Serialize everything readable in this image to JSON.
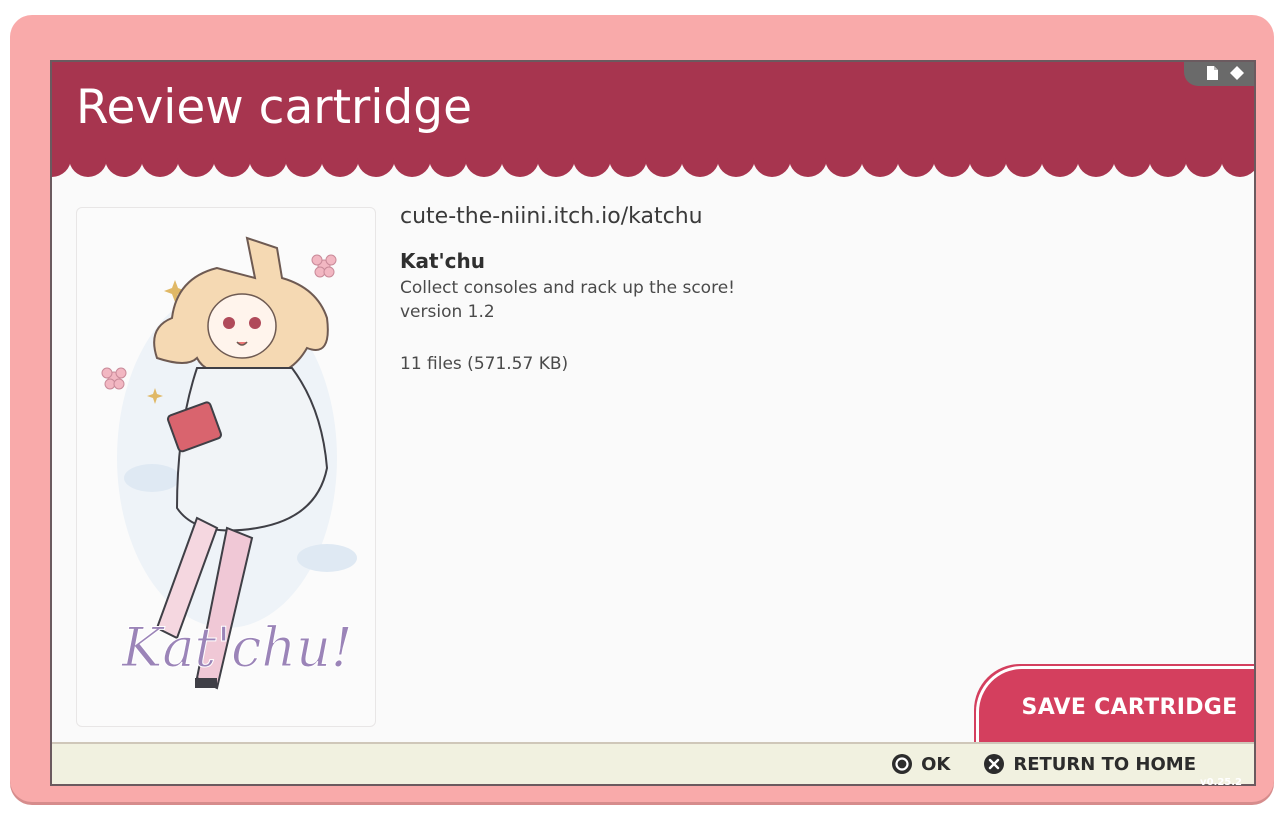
{
  "header": {
    "title": "Review cartridge"
  },
  "status_tray": {
    "icons": [
      "file-icon",
      "diamond-icon"
    ]
  },
  "cartridge": {
    "url": "cute-the-niini.itch.io/katchu",
    "name": "Kat'chu",
    "description": "Collect consoles and rack up the score!",
    "version": "version 1.2",
    "files": "11 files (571.57 KB)",
    "cover_logo_text": "Kat'chu!"
  },
  "actions": {
    "save_label": "SAVE CARTRIDGE"
  },
  "footer": {
    "ok_label": "OK",
    "home_label": "RETURN TO HOME"
  },
  "app_version": "v0.25.2",
  "colors": {
    "frame": "#f9aaaa",
    "header": "#a7354f",
    "save_button": "#d43f5e",
    "footer": "#f1f1e0"
  }
}
